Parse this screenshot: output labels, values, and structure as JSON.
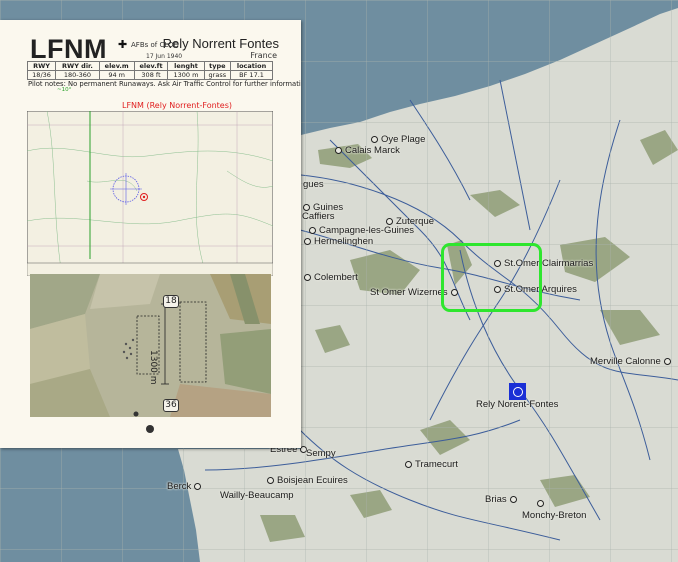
{
  "map": {
    "colors": {
      "sea": "#6f8ea0",
      "land": "#d9dbd3",
      "forest": "#9aa684",
      "roads": "#3c5d9a",
      "highlight": "#2ee62e",
      "marker": "#1a2fd6"
    },
    "towns": [
      {
        "id": "oye-plage",
        "name": "Oye Plage"
      },
      {
        "id": "calais-marck",
        "name": "Calais Marck"
      },
      {
        "id": "guines",
        "name": "Guines"
      },
      {
        "id": "zuterque",
        "name": "Zuterque"
      },
      {
        "id": "campagne-les-guines",
        "name": "Campagne-les-Guines"
      },
      {
        "id": "hermelinghen",
        "name": "Hermelinghen"
      },
      {
        "id": "colembert",
        "name": "Colembert"
      },
      {
        "id": "st-omer-wizernes",
        "name": "St Omer Wizernes"
      },
      {
        "id": "st-omer-clairmarais",
        "name": "St.Omer Clairmarrias"
      },
      {
        "id": "st-omer-arquires",
        "name": "St.Omer Arquires"
      },
      {
        "id": "merville-calonne",
        "name": "Merville Calonne"
      },
      {
        "id": "rely-norrent-fontes",
        "name": "Rely Norent-Fontes"
      },
      {
        "id": "estree",
        "name": "Estree"
      },
      {
        "id": "sempy",
        "name": "Sempy"
      },
      {
        "id": "tramecurt",
        "name": "Tramecurt"
      },
      {
        "id": "berck",
        "name": "Berck"
      },
      {
        "id": "wailly-beaucamp",
        "name": "Wailly-Beaucamp"
      },
      {
        "id": "boisjean-ecuires",
        "name": "Boisjean Ecuires"
      },
      {
        "id": "brias",
        "name": "Brias"
      },
      {
        "id": "monchy-breton",
        "name": "Monchy-Breton"
      }
    ],
    "partial_labels": {
      "gues": "gues",
      "caffiers": "Caffiers"
    }
  },
  "card": {
    "icao": "LFNM",
    "org": "AFBs of CLOD",
    "date": "17 Jun 1940",
    "name": "Rely Norrent Fontes",
    "country": "France",
    "table": {
      "headers": [
        "RWY",
        "RWY dir.",
        "elev.m",
        "elev.ft",
        "lenght",
        "type",
        "location"
      ],
      "row": [
        "18/36",
        "180-360",
        "94 m",
        "308 ft",
        "1300 m",
        "grass",
        "BF 17.1"
      ]
    },
    "notes": "Pilot notes: No permanent Runaways. Ask Air Traffic Control for further information!",
    "topo_label": "LFNM (Rely Norrent-Fontes)",
    "topo_angle": "~10°",
    "runway_top": "18",
    "runway_bottom": "36",
    "runway_length": "1300 m"
  }
}
